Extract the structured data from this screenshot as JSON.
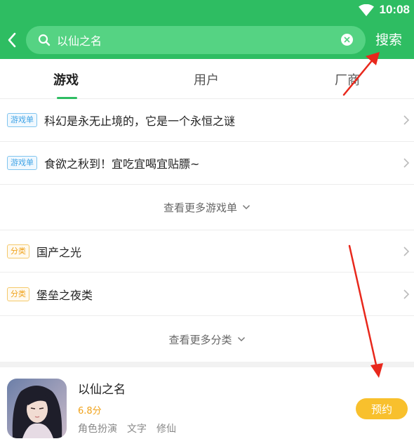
{
  "status_bar": {
    "time": "10:08",
    "icons": [
      "wifi-icon"
    ]
  },
  "search": {
    "value": "以仙之名",
    "button_label": "搜索",
    "icons": [
      "back-icon",
      "search-icon",
      "clear-icon"
    ]
  },
  "tabs": [
    {
      "label": "游戏",
      "active": true
    },
    {
      "label": "用户",
      "active": false
    },
    {
      "label": "厂商",
      "active": false
    }
  ],
  "game_lists": [
    {
      "tag": "游戏单",
      "title": "科幻是永无止境的，它是一个永恒之谜"
    },
    {
      "tag": "游戏单",
      "title": "食欲之秋到！宜吃宜喝宜贴膘~"
    }
  ],
  "more_lists_label": "查看更多游戏单",
  "categories": [
    {
      "tag": "分类",
      "title": "国产之光"
    },
    {
      "tag": "分类",
      "title": "堡垒之夜类"
    }
  ],
  "more_categories_label": "查看更多分类",
  "game": {
    "name": "以仙之名",
    "score": "6.8分",
    "tags": [
      "角色扮演",
      "文字",
      "修仙"
    ],
    "action_label": "预约"
  },
  "colors": {
    "brand_green": "#2ebd62",
    "search_bg": "#55d383",
    "accent_yellow": "#f8c02d",
    "tag_blue": "#3fa3e6",
    "tag_orange": "#f0a21a",
    "annotation_red": "#e8281c"
  }
}
